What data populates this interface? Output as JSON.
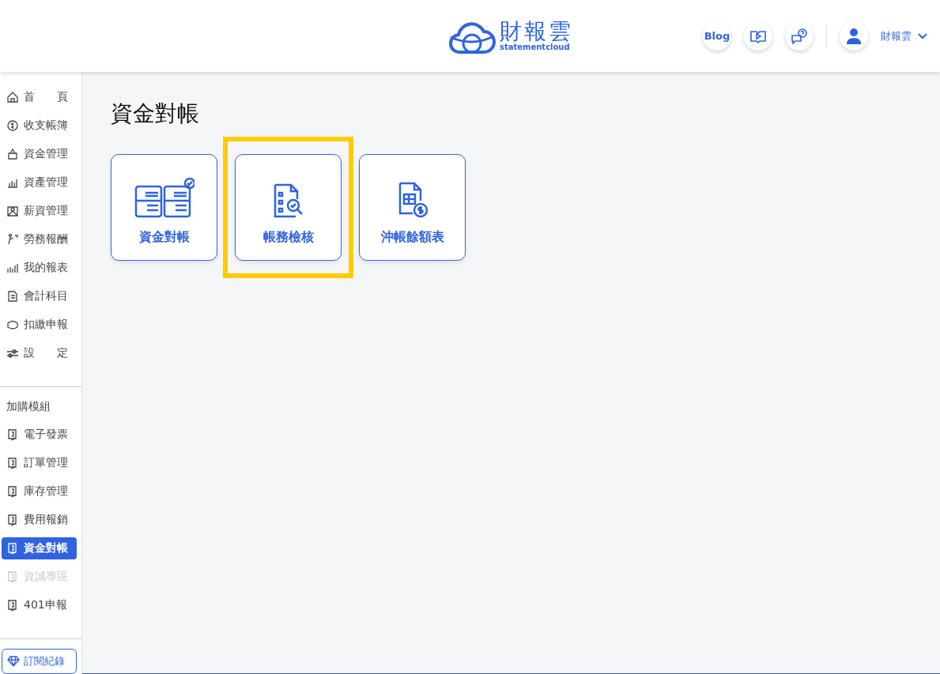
{
  "header": {
    "logo": {
      "name": "財報雲",
      "tagline": "statementcloud"
    },
    "blog_button": "Blog",
    "user": {
      "name": "財報雲"
    }
  },
  "sidebar": {
    "items": [
      {
        "label": "首　　頁",
        "selected": false,
        "disabled": false
      },
      {
        "label": "收支帳簿",
        "selected": false,
        "disabled": false
      },
      {
        "label": "資金管理",
        "selected": false,
        "disabled": false
      },
      {
        "label": "資產管理",
        "selected": false,
        "disabled": false
      },
      {
        "label": "薪資管理",
        "selected": false,
        "disabled": false
      },
      {
        "label": "勞務報酬",
        "selected": false,
        "disabled": false
      },
      {
        "label": "我的報表",
        "selected": false,
        "disabled": false
      },
      {
        "label": "會計科目",
        "selected": false,
        "disabled": false
      },
      {
        "label": "扣繳申報",
        "selected": false,
        "disabled": false
      },
      {
        "label": "設　　定",
        "selected": false,
        "disabled": false
      }
    ],
    "addon_heading": "加購模組",
    "addons": [
      {
        "label": "電子發票",
        "selected": false,
        "disabled": false
      },
      {
        "label": "訂單管理",
        "selected": false,
        "disabled": false
      },
      {
        "label": "庫存管理",
        "selected": false,
        "disabled": false
      },
      {
        "label": "費用報銷",
        "selected": false,
        "disabled": false
      },
      {
        "label": "資金對帳",
        "selected": true,
        "disabled": false
      },
      {
        "label": "資誠專區",
        "selected": false,
        "disabled": true
      },
      {
        "label": "401申報",
        "selected": false,
        "disabled": false
      }
    ],
    "subscription_button": "訂閱紀錄"
  },
  "page": {
    "title": "資金對帳",
    "cards": [
      {
        "label": "資金對帳",
        "highlighted": false
      },
      {
        "label": "帳務檢核",
        "highlighted": true
      },
      {
        "label": "沖帳餘額表",
        "highlighted": false
      }
    ]
  }
}
